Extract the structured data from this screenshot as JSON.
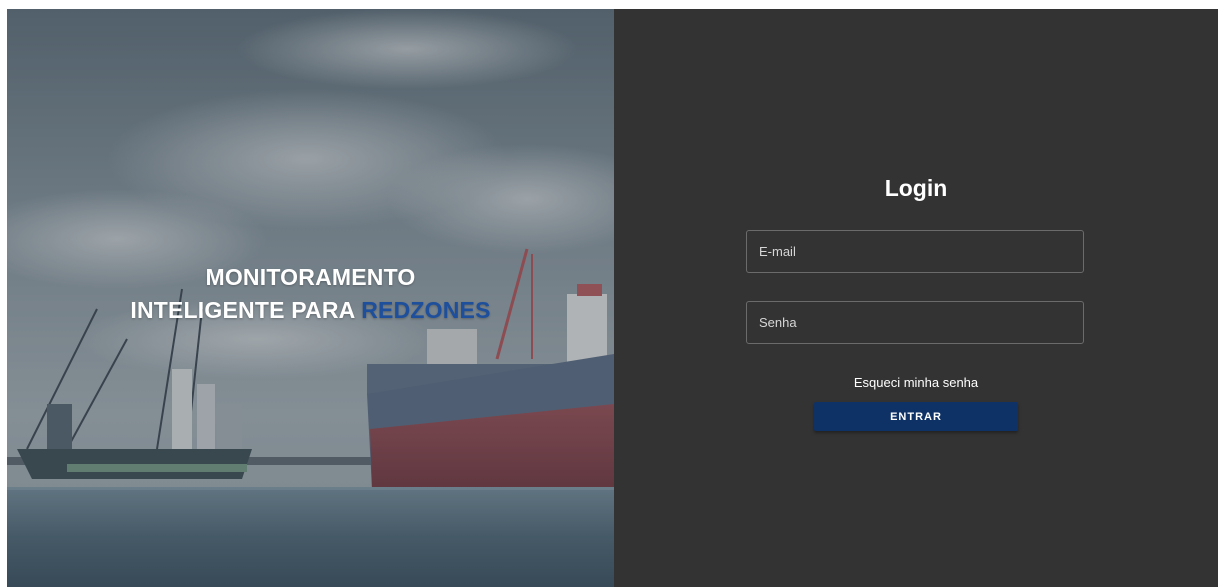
{
  "hero": {
    "title_line1": "MONITORAMENTO",
    "title_line2_prefix": "INTELIGENTE PARA ",
    "title_line2_accent": "REDZONES",
    "accent_color": "#1d4f9c"
  },
  "login": {
    "title": "Login",
    "email_placeholder": "E-mail",
    "email_value": "",
    "password_placeholder": "Senha",
    "password_value": "",
    "forgot_label": "Esqueci minha senha",
    "submit_label": "ENTRAR",
    "submit_color": "#0f3266",
    "panel_color": "#333333"
  }
}
